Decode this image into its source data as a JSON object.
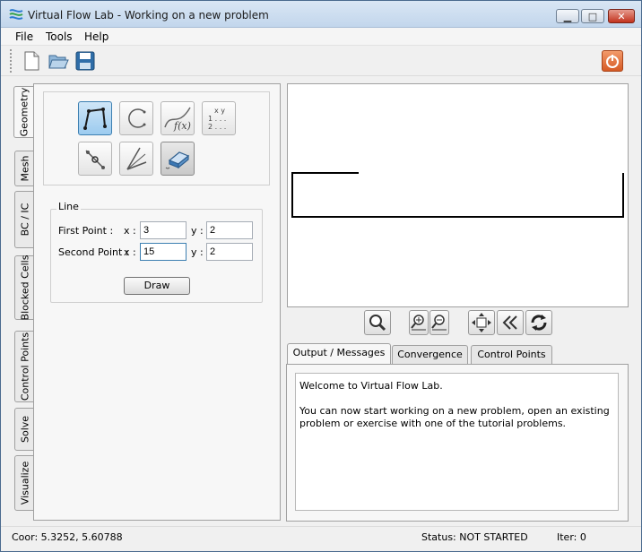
{
  "window": {
    "title": "Virtual Flow Lab - Working on a new problem",
    "minimize_glyph": "▁",
    "maximize_glyph": "□",
    "close_glyph": "✕"
  },
  "menu": [
    "File",
    "Tools",
    "Help"
  ],
  "toolbar": {
    "icons": [
      "new-file-icon",
      "open-folder-icon",
      "save-disk-icon"
    ],
    "power_icon": "power-icon"
  },
  "side_tabs": [
    "Geometry",
    "Mesh",
    "BC / IC",
    "Blocked Cells",
    "Control Points",
    "Solve",
    "Visualize"
  ],
  "geometry_tools": {
    "row1": [
      "polyline-tool-icon",
      "arc-tool-icon",
      "function-curve-tool-icon",
      "coordinates-table-tool-icon"
    ],
    "row1_fx_text": "f(x)",
    "coord_table_text": {
      "head": "x  y",
      "row1": "1 . . .",
      "row2": "2 . . ."
    },
    "row2": [
      "split-point-tool-icon",
      "angle-tool-icon",
      "eraser-tool-icon"
    ]
  },
  "line": {
    "legend": "Line",
    "first_point_label": "First Point :",
    "second_point_label": "Second Point :",
    "x_label": "x :",
    "y_label": "y :",
    "first_x": "3",
    "first_y": "2",
    "second_x": "15",
    "second_y": "2",
    "draw_label": "Draw"
  },
  "view_controls": [
    "zoom-icon",
    "zoom-in-icon",
    "zoom-out-icon",
    "pan-icon",
    "rewind-icon",
    "refresh-icon"
  ],
  "output_tabs": [
    "Output / Messages",
    "Convergence",
    "Control Points"
  ],
  "messages": [
    "Welcome to Virtual Flow Lab.",
    "You can now start working on a new problem, open an existing problem or exercise with one of the tutorial problems."
  ],
  "status": {
    "coords": "Coor: 5.3252, 5.60788",
    "state": "Status: NOT STARTED",
    "iter": "Iter: 0"
  },
  "colors": {
    "accent": "#3c7fb1",
    "close": "#c2321d",
    "power": "#d65a24"
  }
}
